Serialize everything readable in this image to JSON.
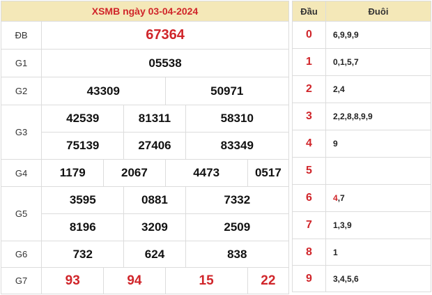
{
  "title": "XSMB ngày 03-04-2024",
  "labels": {
    "db": "ĐB",
    "g1": "G1",
    "g2": "G2",
    "g3": "G3",
    "g4": "G4",
    "g5": "G5",
    "g6": "G6",
    "g7": "G7"
  },
  "prizes": {
    "db": [
      "67364"
    ],
    "g1": [
      "05538"
    ],
    "g2": [
      "43309",
      "50971"
    ],
    "g3": [
      "42539",
      "81311",
      "58310",
      "75139",
      "27406",
      "83349"
    ],
    "g4": [
      "1179",
      "2067",
      "4473",
      "0517"
    ],
    "g5": [
      "3595",
      "0881",
      "7332",
      "8196",
      "3209",
      "2509"
    ],
    "g6": [
      "732",
      "624",
      "838"
    ],
    "g7": [
      "93",
      "94",
      "15",
      "22"
    ]
  },
  "side": {
    "header_dau": "Đầu",
    "header_duoi": "Đuôi",
    "rows": [
      {
        "dau": "0",
        "duoi": "6,9,9,9"
      },
      {
        "dau": "1",
        "duoi": "0,1,5,7"
      },
      {
        "dau": "2",
        "duoi": "2,4"
      },
      {
        "dau": "3",
        "duoi": "2,2,8,8,9,9"
      },
      {
        "dau": "4",
        "duoi": "9"
      },
      {
        "dau": "5",
        "duoi": ""
      },
      {
        "dau": "6",
        "duoi_hl": "4",
        "duoi_rest": ",7"
      },
      {
        "dau": "7",
        "duoi": "1,3,9"
      },
      {
        "dau": "8",
        "duoi": "1"
      },
      {
        "dau": "9",
        "duoi": "3,4,5,6"
      }
    ]
  },
  "colors": {
    "accent": "#d0252a",
    "header_bg": "#f4e8b8",
    "border": "#dcdcdc"
  }
}
